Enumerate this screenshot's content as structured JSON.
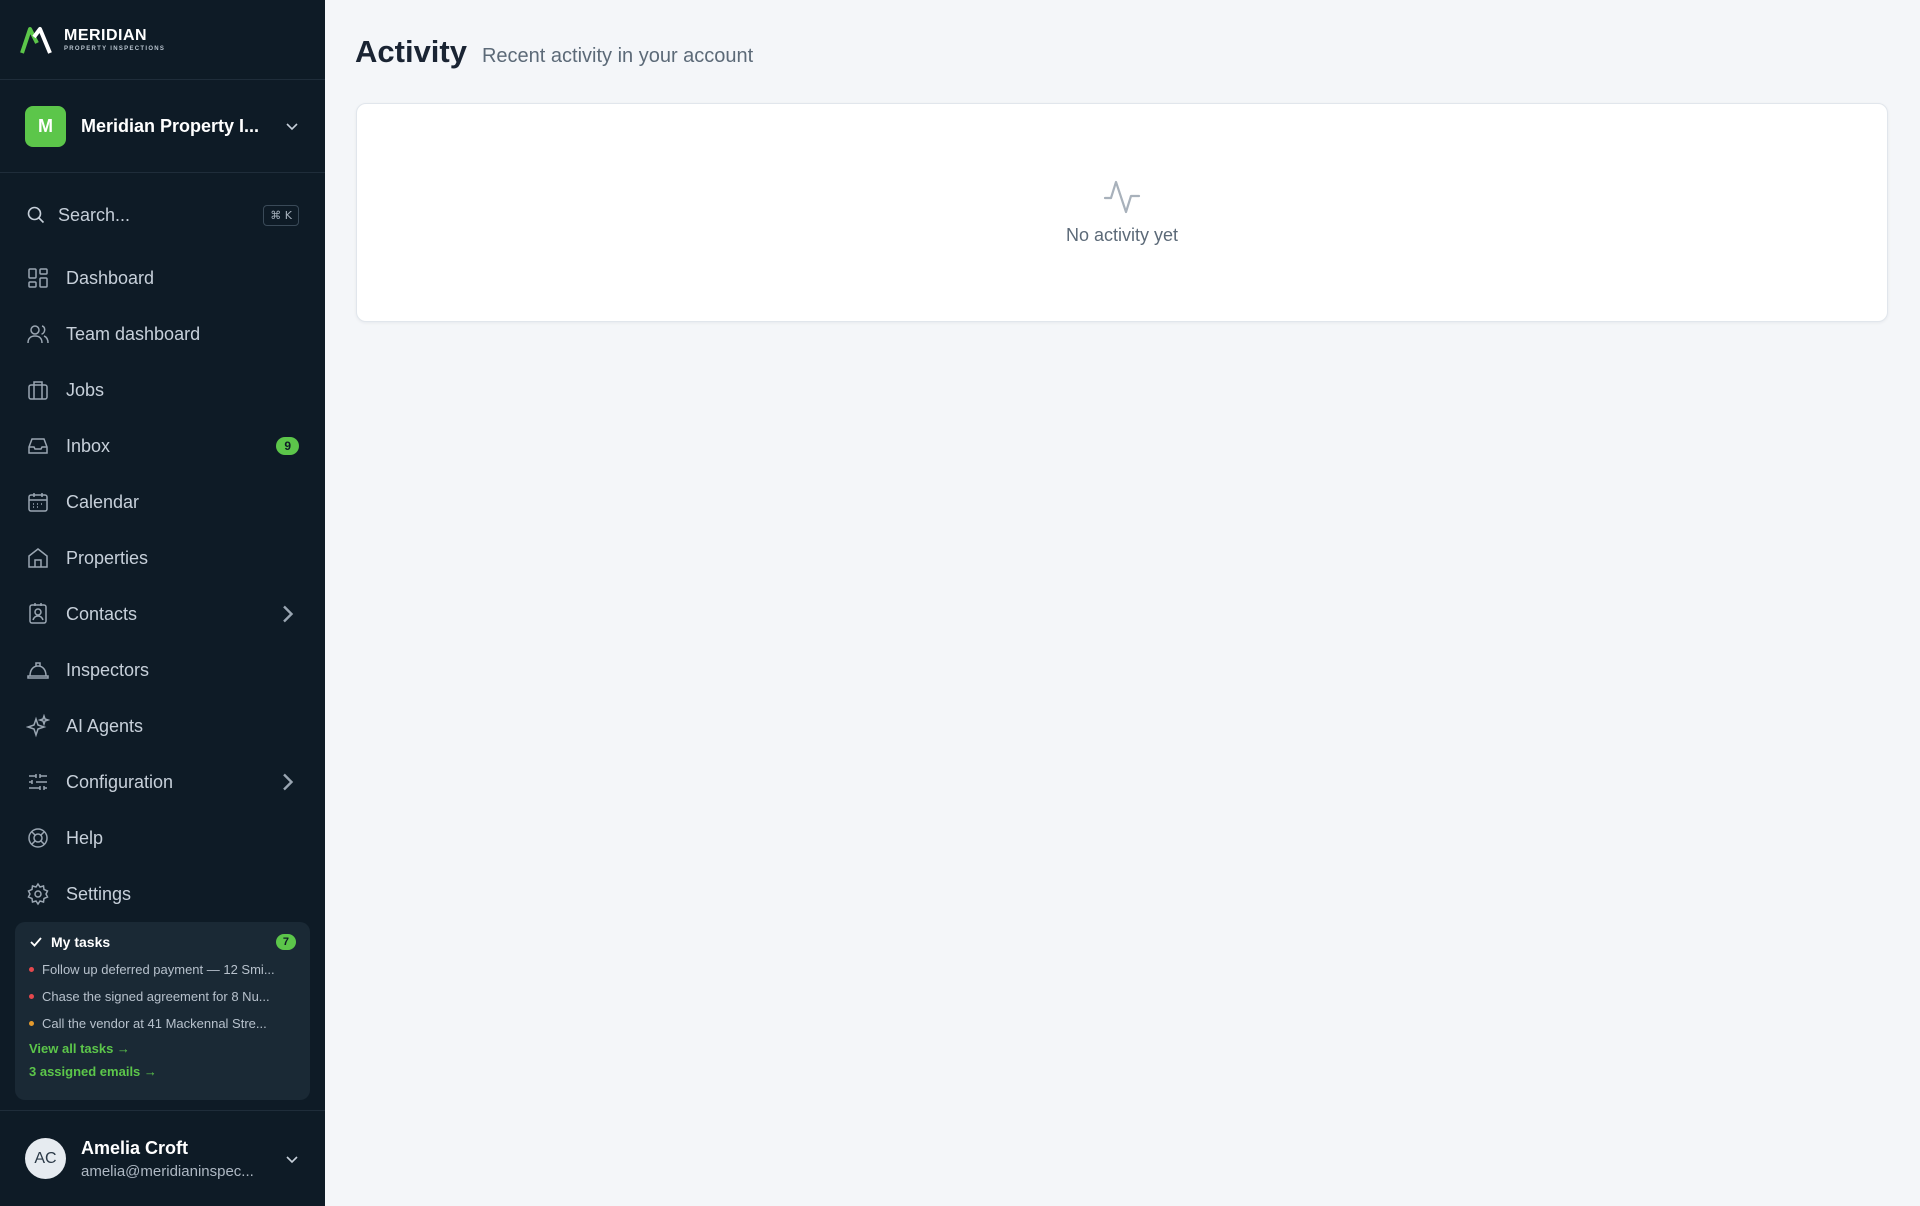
{
  "brand": {
    "name": "MERIDIAN",
    "tagline": "PROPERTY INSPECTIONS",
    "accent": "#5cc64a"
  },
  "org": {
    "initial": "M",
    "name": "Meridian Property I..."
  },
  "search": {
    "placeholder": "Search...",
    "shortcut": "⌘ K"
  },
  "nav": [
    {
      "label": "Dashboard",
      "icon": "dashboard-icon"
    },
    {
      "label": "Team dashboard",
      "icon": "users-icon"
    },
    {
      "label": "Jobs",
      "icon": "briefcase-icon"
    },
    {
      "label": "Inbox",
      "icon": "inbox-icon",
      "badge": "9"
    },
    {
      "label": "Calendar",
      "icon": "calendar-icon"
    },
    {
      "label": "Properties",
      "icon": "home-icon"
    },
    {
      "label": "Contacts",
      "icon": "contact-icon",
      "expandable": true
    },
    {
      "label": "Inspectors",
      "icon": "hard-hat-icon"
    },
    {
      "label": "AI Agents",
      "icon": "sparkles-icon"
    },
    {
      "label": "Configuration",
      "icon": "sliders-icon",
      "expandable": true
    },
    {
      "label": "Help",
      "icon": "lifebuoy-icon"
    },
    {
      "label": "Settings",
      "icon": "gear-icon"
    }
  ],
  "tasks": {
    "title": "My tasks",
    "count": "7",
    "items": [
      {
        "text": "Follow up deferred payment — 12 Smi...",
        "priority_color": "#e5484d"
      },
      {
        "text": "Chase the signed agreement for 8 Nu...",
        "priority_color": "#e5484d"
      },
      {
        "text": "Call the vendor at 41 Mackennal Stre...",
        "priority_color": "#e59a2d"
      }
    ],
    "view_all": "View all tasks →",
    "assigned_emails": "3 assigned emails →"
  },
  "user": {
    "initials": "AC",
    "name": "Amelia Croft",
    "email": "amelia@meridianinspec..."
  },
  "page": {
    "title": "Activity",
    "subtitle": "Recent activity in your account"
  },
  "empty_state": {
    "icon": "activity-icon",
    "message": "No activity yet"
  }
}
